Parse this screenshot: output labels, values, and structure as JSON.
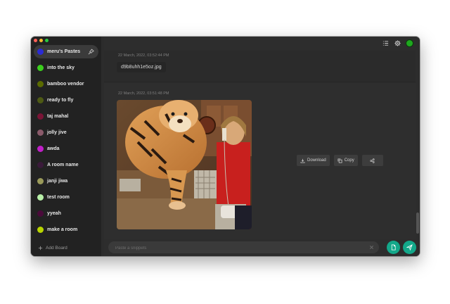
{
  "window": {
    "traffic_colors": [
      "#ff5f57",
      "#febc2e",
      "#28c840"
    ]
  },
  "sidebar": {
    "items": [
      {
        "label": "meru's Pastes",
        "color": "#2b2bd4",
        "active": true
      },
      {
        "label": "into the sky",
        "color": "#3ccf1e"
      },
      {
        "label": "bamboo vendor",
        "color": "#5b6b00"
      },
      {
        "label": "ready to fly",
        "color": "#4e5a14"
      },
      {
        "label": "taj mahal",
        "color": "#7a1436"
      },
      {
        "label": "jolly jive",
        "color": "#8a5a6a"
      },
      {
        "label": "awda",
        "color": "#c020c8"
      },
      {
        "label": "A room name",
        "color": "#3a1a3a"
      },
      {
        "label": "janji jiwa",
        "color": "#9a9a5a"
      },
      {
        "label": "test room",
        "color": "#b8f0a8"
      },
      {
        "label": "yyeah",
        "color": "#4a0a3a"
      },
      {
        "label": "make a room",
        "color": "#b8d400"
      }
    ],
    "add_board_label": "Add Board"
  },
  "toolbar": {
    "icons": [
      "list-icon",
      "gear-icon",
      "status-icon"
    ]
  },
  "entries": [
    {
      "timestamp": "22 March, 2022, 03:52:44 PM",
      "filename": "d9b8uhh1e5oz.jpg"
    },
    {
      "timestamp": "22 March, 2022, 03:51:48 PM"
    }
  ],
  "actions": {
    "download_label": "Download",
    "copy_label": "Copy"
  },
  "composer": {
    "placeholder": "Paste a snippets"
  },
  "colors": {
    "accent": "#13a88a"
  }
}
